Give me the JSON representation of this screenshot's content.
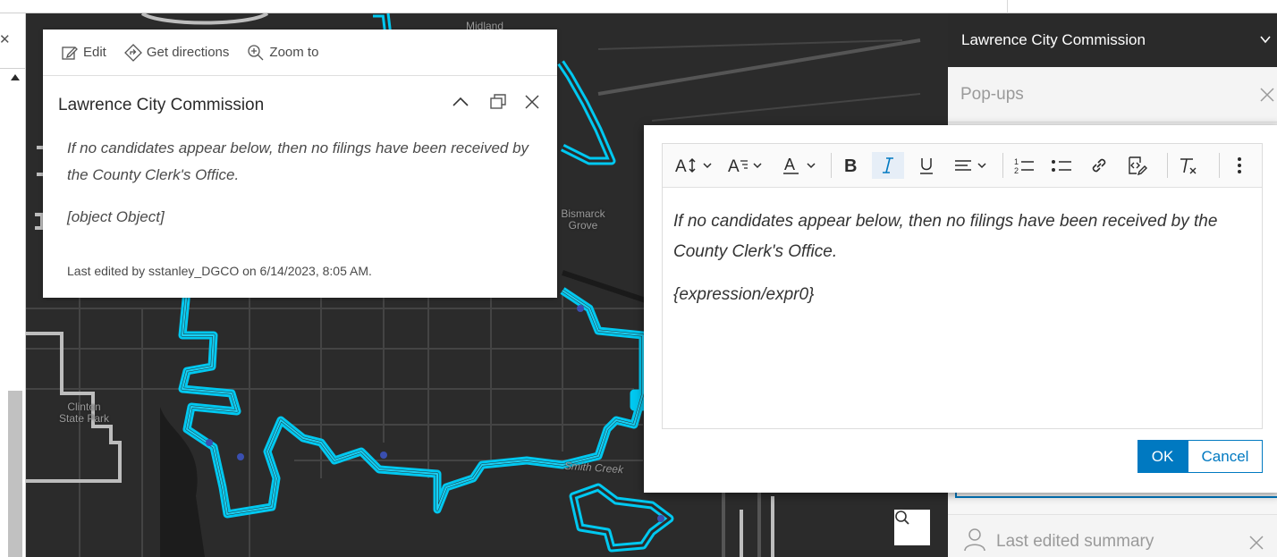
{
  "map": {
    "labels": {
      "midland": "Midland",
      "bismarck_grove": "Bismarck\nGrove",
      "clinton_state_park": "Clinton\nState Park",
      "creek": "Smith Creek"
    },
    "colors": {
      "boundary": "#00c8f0",
      "roads": "#4a4a4a",
      "background": "#2b2b2b"
    },
    "search_icon": "search-icon"
  },
  "popup": {
    "actions": {
      "edit": "Edit",
      "directions": "Get directions",
      "zoom": "Zoom to"
    },
    "title": "Lawrence City Commission",
    "body_text": "If no candidates appear below, then no filings have been received by the County Clerk's Office.",
    "object_text": "[object Object]",
    "last_edited": "Last edited by sstanley_DGCO on 6/14/2023, 8:05 AM."
  },
  "sidepanel": {
    "header_title": "Lawrence City Commission",
    "popups_label": "Pop-ups",
    "last_edited_label": "Last edited summary",
    "accent": "#0079c1"
  },
  "dialog": {
    "content_text": "If no candidates appear below, then no filings have been received by the County Clerk's Office.",
    "expression_text": "{expression/expr0}",
    "ok_label": "OK",
    "cancel_label": "Cancel"
  }
}
